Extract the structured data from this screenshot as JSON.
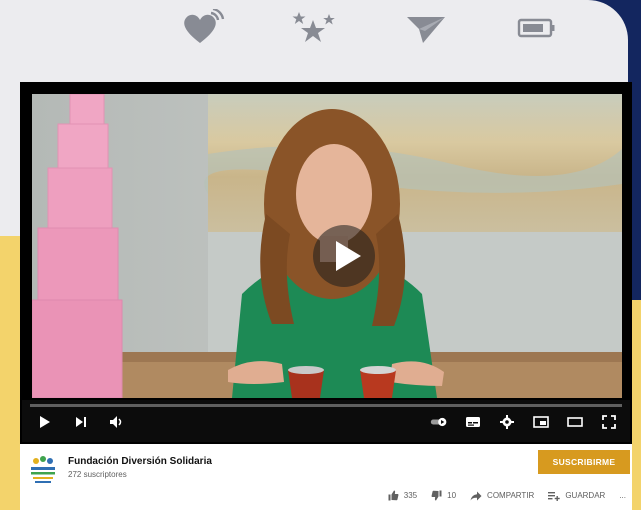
{
  "top_icons": [
    {
      "name": "heart-signal-icon"
    },
    {
      "name": "stars-icon"
    },
    {
      "name": "paper-plane-icon"
    },
    {
      "name": "battery-icon"
    }
  ],
  "channel": {
    "name": "Fundación Diversión Solidaria",
    "subscribers": "272 suscriptores"
  },
  "subscribe_label": "SUSCRIBIRME",
  "actions": {
    "likes": "335",
    "dislikes": "10",
    "share": "COMPARTIR",
    "save": "GUARDAR",
    "more": "..."
  },
  "colors": {
    "navy": "#13265f",
    "yellow": "#f3d36b",
    "subscribe": "#d79a1f",
    "icon_gray": "#888b94"
  }
}
